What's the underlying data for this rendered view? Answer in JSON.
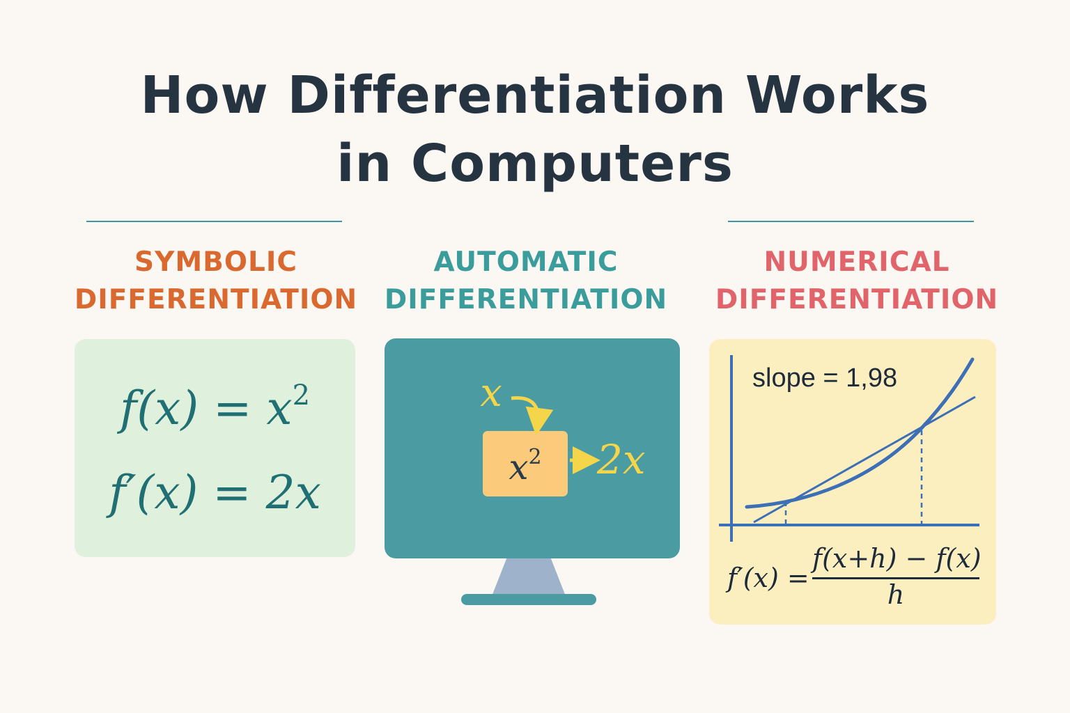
{
  "title": {
    "line1": "How Differentiation Works",
    "line2": "in Computers"
  },
  "colors": {
    "background": "#fbf7f2",
    "title": "#263442",
    "rule": "#3e95a3",
    "symbolic": "#d9692f",
    "automatic": "#3a9d9c",
    "numerical": "#e06469",
    "symbolic_card": "#dff1dd",
    "automatic_screen": "#4a9ca2",
    "automatic_stand": "#9fb2cb",
    "numerical_card": "#fcefbf",
    "accent_yellow": "#f5d54a",
    "box_orange": "#fbca7a",
    "curve_blue": "#3c6fb5"
  },
  "sections": {
    "symbolic": {
      "heading_line1": "SYMBOLIC",
      "heading_line2": "DIFFERENTIATION",
      "function": "f(x) = x",
      "function_exponent": "2",
      "derivative": "f′(x) = 2x"
    },
    "automatic": {
      "heading_line1": "AUTOMATIC",
      "heading_line2": "DIFFERENTIATION",
      "input": "x",
      "box_base": "x",
      "box_exponent": "2",
      "output": "2x",
      "icons": [
        "monitor-icon",
        "arrow-icon"
      ]
    },
    "numerical": {
      "heading_line1": "NUMERICAL",
      "heading_line2": "DIFFERENTIATION",
      "slope_label": "slope = 1,98",
      "formula_lhs": "f′(x) =",
      "formula_numerator": "f(x+h) − f(x)",
      "formula_denominator": "h"
    }
  }
}
